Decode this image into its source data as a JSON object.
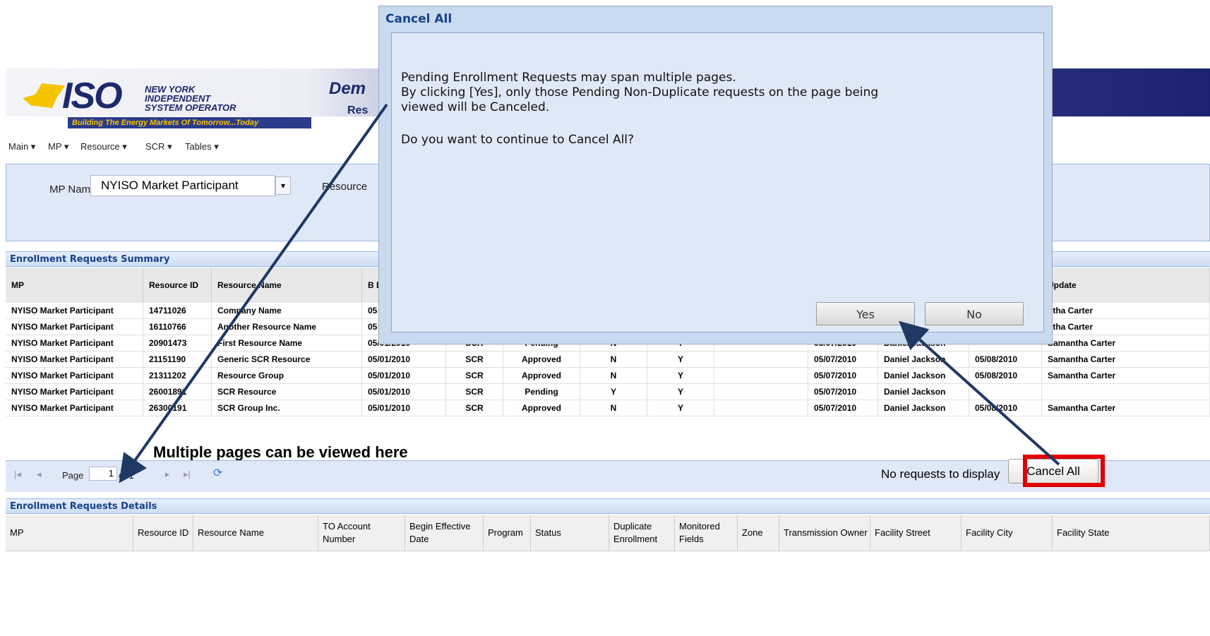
{
  "header": {
    "logo_iso": "ISO",
    "logo_lines": [
      "NEW YORK",
      "INDEPENDENT",
      "SYSTEM OPERATOR"
    ],
    "tagline": "Building The Energy Markets Of Tomorrow...Today",
    "app_title": "Dem",
    "app_subtitle": "Res"
  },
  "menu": [
    "Main",
    "MP",
    "Resource",
    "SCR",
    "Tables"
  ],
  "filter": {
    "mp_label": "MP Name:",
    "mp_value": "NYISO Market Participant",
    "resource_label": "Resource"
  },
  "summary": {
    "title": "Enrollment Requests Summary",
    "columns": [
      "MP",
      "Resource ID",
      "Resource Name",
      "B D",
      "",
      "",
      "",
      "",
      "",
      "",
      "",
      "Update"
    ],
    "rows": [
      [
        "NYISO Market Participant",
        "14711026",
        "Company Name",
        "05",
        "",
        "",
        "",
        "",
        "",
        "",
        "",
        "ntha Carter"
      ],
      [
        "NYISO Market Participant",
        "16110766",
        "Another Resource Name",
        "05",
        "",
        "",
        "",
        "",
        "",
        "",
        "",
        "ntha Carter"
      ],
      [
        "NYISO Market Participant",
        "20901473",
        "First Resource Name",
        "05/01/2010",
        "SCR",
        "Pending",
        "N",
        "Y",
        "",
        "05/07/2010",
        "Daniel Jackson",
        "Samantha Carter"
      ],
      [
        "NYISO Market Participant",
        "21151190",
        "Generic SCR Resource",
        "05/01/2010",
        "SCR",
        "Approved",
        "N",
        "Y",
        "",
        "05/07/2010",
        "Daniel Jackson",
        "05/08/2010",
        "Samantha Carter"
      ],
      [
        "NYISO Market Participant",
        "21311202",
        "Resource Group",
        "05/01/2010",
        "SCR",
        "Approved",
        "N",
        "Y",
        "",
        "05/07/2010",
        "Daniel Jackson",
        "05/08/2010",
        "Samantha Carter"
      ],
      [
        "NYISO Market Participant",
        "26001891",
        "SCR Resource",
        "05/01/2010",
        "SCR",
        "Pending",
        "Y",
        "Y",
        "",
        "05/07/2010",
        "Daniel Jackson",
        "",
        ""
      ],
      [
        "NYISO Market Participant",
        "26300191",
        "SCR Group Inc.",
        "05/01/2010",
        "SCR",
        "Approved",
        "N",
        "Y",
        "",
        "05/07/2010",
        "Daniel Jackson",
        "05/08/2010",
        "Samantha Carter"
      ]
    ]
  },
  "callout": "Multiple pages can be viewed here",
  "pager": {
    "page_label": "Page",
    "page_value": "1",
    "of_label": "of 1",
    "status": "No requests to display",
    "cancel_all": "Cancel All"
  },
  "details": {
    "title": "Enrollment Requests Details",
    "columns": [
      "MP",
      "Resource ID",
      "Resource Name",
      "TO Account Number",
      "Begin Effective Date",
      "Program",
      "Status",
      "Duplicate Enrollment",
      "Monitored Fields",
      "Zone",
      "Transmission Owner",
      "Facility Street",
      "Facility City",
      "Facility State"
    ]
  },
  "dialog": {
    "title": "Cancel All",
    "line1": "Pending Enrollment Requests may span multiple pages.",
    "line2": "By clicking [Yes], only those Pending Non-Duplicate requests on the page being",
    "line3": "viewed will be Canceled.",
    "question": "Do you want to continue to Cancel All?",
    "yes": "Yes",
    "no": "No"
  },
  "colors": {
    "arrow": "#1f3864",
    "highlight": "#e00000",
    "header_text": "#15428b"
  }
}
